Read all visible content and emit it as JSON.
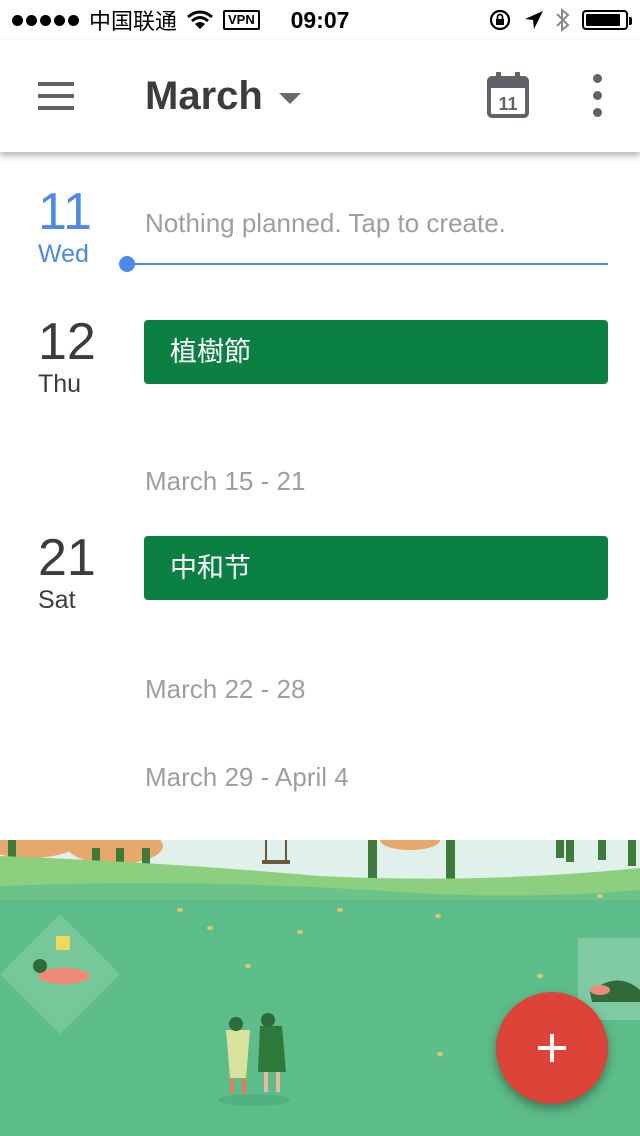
{
  "status_bar": {
    "carrier": "中国联通",
    "vpn": "VPN",
    "time": "09:07",
    "battery_level": 0.9
  },
  "header": {
    "month": "March",
    "today_icon_day": "11",
    "icons": [
      "menu-icon",
      "dropdown-caret-icon",
      "calendar-today-icon",
      "more-vert-icon"
    ]
  },
  "days": [
    {
      "num": "11",
      "name": "Wed",
      "today": true,
      "empty_text": "Nothing planned. Tap to create."
    },
    {
      "num": "12",
      "name": "Thu",
      "event": "植樹節"
    },
    {
      "num": "21",
      "name": "Sat",
      "event": "中和节"
    }
  ],
  "weeks": [
    "March 15 - 21",
    "March 22 - 28",
    "March 29 - April 4"
  ],
  "colors": {
    "accent_blue": "#4a8bea",
    "event_green": "#0b8043",
    "fab_red": "#db4437",
    "grass": "#5cbd8a"
  }
}
